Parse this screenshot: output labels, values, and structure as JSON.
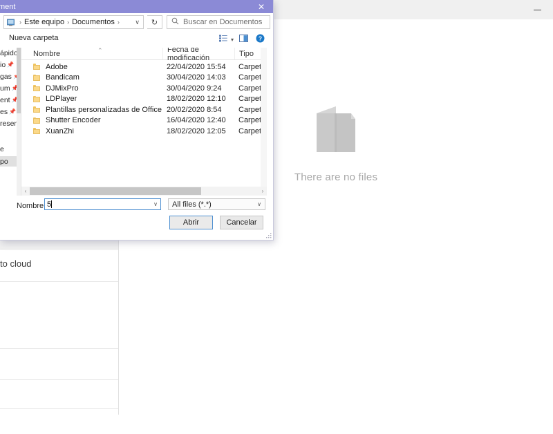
{
  "background_window": {
    "minimize_label": "–",
    "empty_state": {
      "icon": "documents-icon",
      "message": "There are no files"
    },
    "left_panel": {
      "row_cloud_label": "to cloud"
    }
  },
  "dialog": {
    "title": "ment",
    "close_label": "✕",
    "address": {
      "icon": "computer-icon",
      "crumbs": [
        "Este equipo",
        "Documentos"
      ],
      "separator": "›",
      "dropdown_caret": "∨"
    },
    "refresh_label": "↻",
    "search": {
      "icon": "search-icon",
      "placeholder": "Buscar en Documentos"
    },
    "commandbar": {
      "new_folder_label": "Nueva carpeta",
      "view_icon": "view-options-icon",
      "view_caret": "▾",
      "pane_icon": "preview-pane-icon",
      "help_icon": "help-icon"
    },
    "sidebar": {
      "items": [
        {
          "label": "ápido",
          "pinned": false,
          "selected": false
        },
        {
          "label": "io",
          "pinned": true,
          "selected": false
        },
        {
          "label": "gas",
          "pinned": true,
          "selected": false
        },
        {
          "label": "um",
          "pinned": true,
          "selected": false
        },
        {
          "label": "ent",
          "pinned": true,
          "selected": false
        },
        {
          "label": "es",
          "pinned": true,
          "selected": false
        },
        {
          "label": "resent",
          "pinned": false,
          "selected": false
        },
        {
          "label": "e",
          "pinned": false,
          "selected": false
        },
        {
          "label": "po",
          "pinned": false,
          "selected": true
        }
      ]
    },
    "filelist": {
      "columns": [
        "Nombre",
        "Fecha de modificación",
        "Tipo"
      ],
      "sort_caret": "⌃",
      "rows": [
        {
          "name": "Adobe",
          "date": "22/04/2020 15:54",
          "type": "Carpeta de a"
        },
        {
          "name": "Bandicam",
          "date": "30/04/2020 14:03",
          "type": "Carpeta de a"
        },
        {
          "name": "DJMixPro",
          "date": "30/04/2020 9:24",
          "type": "Carpeta de a"
        },
        {
          "name": "LDPlayer",
          "date": "18/02/2020 12:10",
          "type": "Carpeta de a"
        },
        {
          "name": "Plantillas personalizadas de Office",
          "date": "20/02/2020 8:54",
          "type": "Carpeta de a"
        },
        {
          "name": "Shutter Encoder",
          "date": "16/04/2020 12:40",
          "type": "Carpeta de a"
        },
        {
          "name": "XuanZhi",
          "date": "18/02/2020 12:05",
          "type": "Carpeta de a"
        }
      ],
      "scroll_left_arrow": "‹",
      "scroll_right_arrow": "›"
    },
    "bottom": {
      "name_label": "Nombre:",
      "name_value": "5",
      "name_caret": "∨",
      "filetype_value": "All files (*.*)",
      "filetype_caret": "∨",
      "open_button": "Abrir",
      "cancel_button": "Cancelar"
    }
  },
  "colors": {
    "title_purple": "#8b8ad6",
    "accent_blue": "#4d8fd1",
    "folder_yellow": "#fbd98a",
    "empty_gray": "#c4c4c4"
  }
}
